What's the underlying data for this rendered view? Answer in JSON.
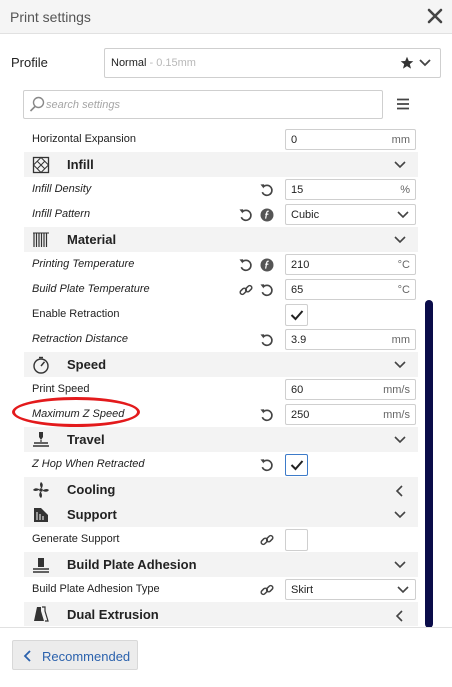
{
  "window": {
    "title": "Print settings"
  },
  "profile": {
    "label": "Profile",
    "name": "Normal",
    "subname": " - 0.15mm"
  },
  "search": {
    "placeholder": "search settings"
  },
  "rows": {
    "horizontal_expansion": {
      "label": "Horizontal Expansion",
      "value": "0",
      "unit": "mm"
    },
    "infill_density": {
      "label": "Infill Density",
      "value": "15",
      "unit": "%"
    },
    "infill_pattern": {
      "label": "Infill Pattern",
      "value": "Cubic"
    },
    "printing_temperature": {
      "label": "Printing Temperature",
      "value": "210",
      "unit": "°C"
    },
    "build_plate_temperature": {
      "label": "Build Plate Temperature",
      "value": "65",
      "unit": "°C"
    },
    "enable_retraction": {
      "label": "Enable Retraction",
      "checked": true
    },
    "retraction_distance": {
      "label": "Retraction Distance",
      "value": "3.9",
      "unit": "mm"
    },
    "print_speed": {
      "label": "Print Speed",
      "value": "60",
      "unit": "mm/s"
    },
    "maximum_z_speed": {
      "label": "Maximum Z Speed",
      "value": "250",
      "unit": "mm/s"
    },
    "z_hop_when_retracted": {
      "label": "Z Hop When Retracted",
      "checked": true
    },
    "generate_support": {
      "label": "Generate Support",
      "checked": false
    },
    "build_plate_adhesion_type": {
      "label": "Build Plate Adhesion Type",
      "value": "Skirt"
    }
  },
  "categories": {
    "infill": {
      "title": "Infill",
      "icon": "infill-icon",
      "expanded": true
    },
    "material": {
      "title": "Material",
      "icon": "material-icon",
      "expanded": true
    },
    "speed": {
      "title": "Speed",
      "icon": "speed-icon",
      "expanded": true
    },
    "travel": {
      "title": "Travel",
      "icon": "travel-icon",
      "expanded": true
    },
    "cooling": {
      "title": "Cooling",
      "icon": "cooling-icon",
      "expanded": false
    },
    "support": {
      "title": "Support",
      "icon": "support-icon",
      "expanded": true
    },
    "adhesion": {
      "title": "Build Plate Adhesion",
      "icon": "adhesion-icon",
      "expanded": true
    },
    "dual": {
      "title": "Dual Extrusion",
      "icon": "dual-extrusion-icon",
      "expanded": false
    }
  },
  "footer": {
    "recommended_label": "Recommended"
  },
  "colors": {
    "accent": "#2b62ad",
    "scrollbar": "#0a0c49",
    "highlight": "#e31a1c"
  }
}
